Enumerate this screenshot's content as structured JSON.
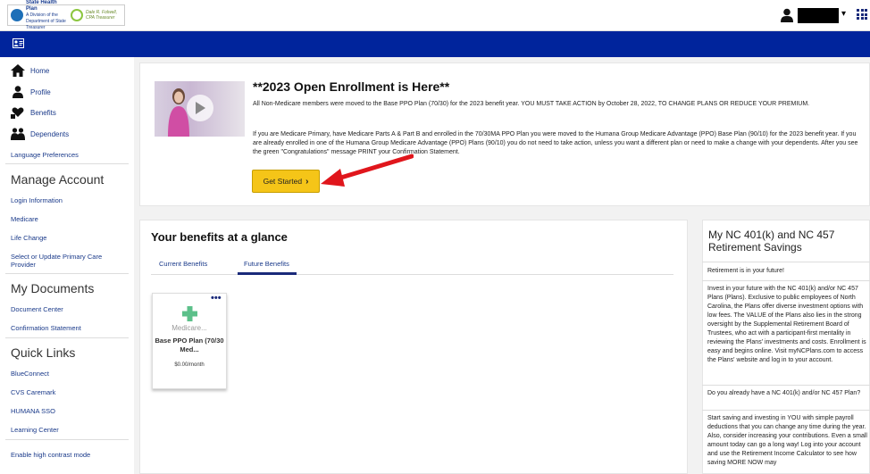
{
  "header": {
    "logo_title": "State Health Plan",
    "logo_subtitle": "A Division of the Department of State Treasurer",
    "logo_cobrand": "Dale R. Folwell, CPA Treasurer",
    "user_name": ""
  },
  "sidebar": {
    "nav": [
      {
        "label": "Home",
        "icon": "home-icon"
      },
      {
        "label": "Profile",
        "icon": "person-icon"
      },
      {
        "label": "Benefits",
        "icon": "heart-hands-icon"
      },
      {
        "label": "Dependents",
        "icon": "people-icon"
      }
    ],
    "language_preferences": "Language Preferences",
    "manage_account": {
      "heading": "Manage Account",
      "links": [
        "Login Information",
        "Medicare",
        "Life Change",
        "Select or Update Primary Care Provider"
      ]
    },
    "my_documents": {
      "heading": "My Documents",
      "links": [
        "Document Center",
        "Confirmation Statement"
      ]
    },
    "quick_links": {
      "heading": "Quick Links",
      "links": [
        "BlueConnect",
        "CVS Caremark",
        "HUMANA SSO",
        "Learning Center"
      ]
    },
    "high_contrast": "Enable high contrast mode"
  },
  "enrollment": {
    "title": "**2023 Open Enrollment is Here**",
    "paragraph1": "All Non-Medicare members were moved to the Base PPO Plan (70/30) for the 2023 benefit year. YOU MUST TAKE ACTION by October 28, 2022, TO CHANGE PLANS OR REDUCE YOUR PREMIUM.",
    "paragraph2": "If you are Medicare Primary, have Medicare Parts A & Part B and enrolled in the 70/30MA PPO Plan you were moved to the Humana Group Medicare Advantage (PPO) Base Plan (90/10) for the 2023 benefit year. If you are already enrolled in one of the Humana Group Medicare Advantage (PPO) Plans (90/10) you do not need to take action, unless you want a different plan or need to make a change with your dependents. After you see the green \"Congratulations\" message PRINT your Confirmation Statement.",
    "button": "Get Started",
    "button_chevron": "›"
  },
  "benefits": {
    "title": "Your benefits at a glance",
    "tabs": [
      "Current Benefits",
      "Future Benefits"
    ],
    "active_tab": "Future Benefits",
    "plan": {
      "type": "Medicare...",
      "name": "Base PPO Plan (70/30 Med...",
      "price": "$0.00/month",
      "menu": "•••"
    }
  },
  "retirement": {
    "title": "My NC 401(k) and NC 457 Retirement Savings",
    "tagline": "Retirement is in your future!",
    "paragraph1": "Invest in your future with the NC 401(k) and/or NC 457 Plans (Plans). Exclusive to public employees of North Carolina, the Plans offer diverse investment options with low fees. The VALUE of the Plans also lies in the strong oversight by the Supplemental Retirement Board of Trustees, who act with a participant-first mentality in reviewing the Plans' investments and costs. Enrollment is easy and begins online. Visit myNCPlans.com to access the Plans' website and log in to your account.",
    "question": "Do you already have a NC 401(k) and/or NC 457 Plan?",
    "paragraph2": "Start saving and investing in YOU with simple payroll deductions that you can change any time during the year. Also, consider increasing your contributions. Even a small amount today can go a long way! Log into your account and use the Retirement Income Calculator to see how saving MORE NOW may"
  },
  "colors": {
    "nav_band": "#00249c",
    "link": "#1a3a8a",
    "button": "#f5c518",
    "arrow": "#e0161c",
    "plan_cross": "#5cc08a"
  }
}
